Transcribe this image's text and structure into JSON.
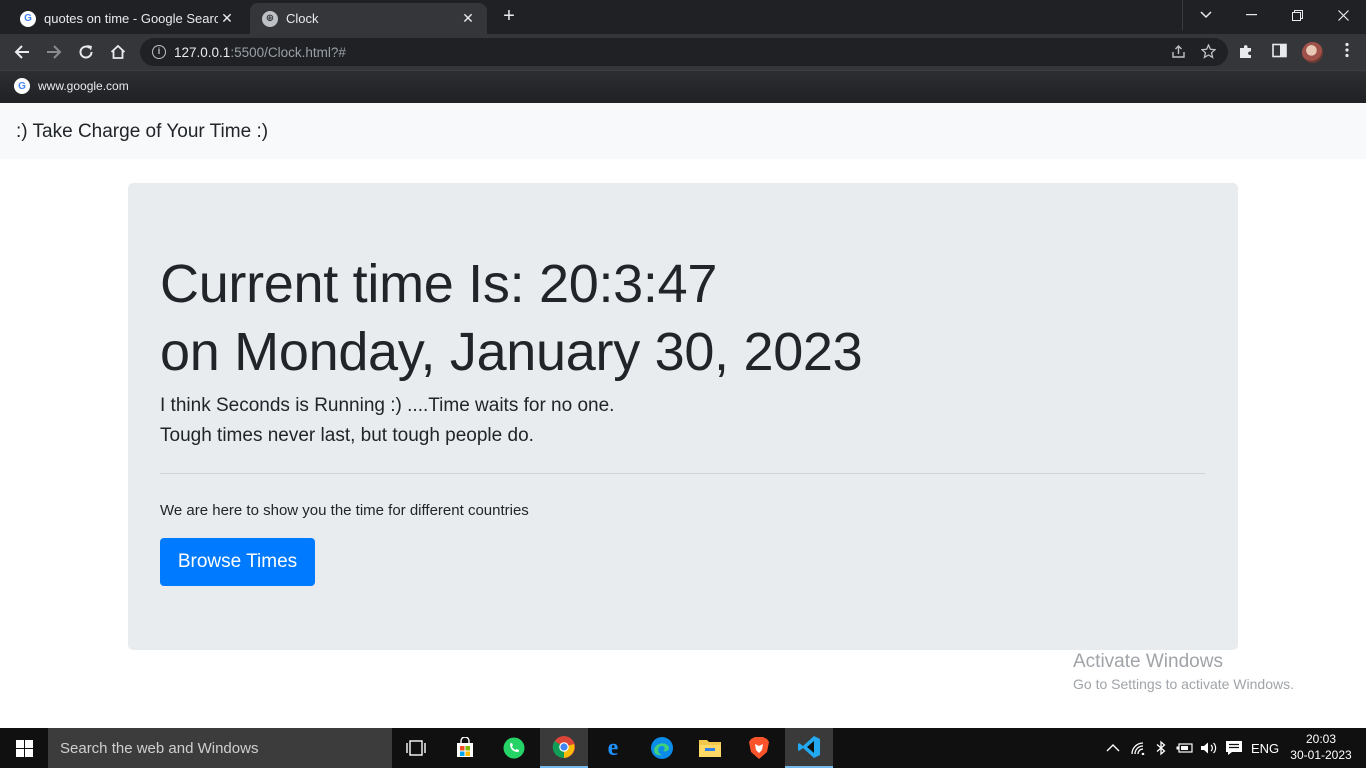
{
  "browser": {
    "tabs": [
      {
        "title": "quotes on time - Google Search",
        "favicon": "google-favicon",
        "active": false
      },
      {
        "title": "Clock",
        "favicon": "globe-favicon",
        "active": true
      }
    ],
    "url": {
      "host": "127.0.0.1",
      "rest": ":5500/Clock.html?#"
    },
    "bookmark": "www.google.com",
    "new_tab_symbol": "+",
    "tab_close_symbol": "✕"
  },
  "page": {
    "brand": ":) Take Charge of Your Time :)",
    "jumbotron": {
      "time_line": "Current time Is: 20:3:47",
      "date_line": "on Monday, January 30, 2023",
      "lead_1": "I think Seconds is Running :) ....Time waits for no one.",
      "lead_2": "Tough times never last, but tough people do.",
      "paragraph": "We are here to show you the time for different countries",
      "button": "Browse Times"
    },
    "colors": {
      "primary": "#007bff",
      "jumbotron_bg": "#e9ecef",
      "navbar_bg": "#f8f9fa"
    }
  },
  "watermark": {
    "title": "Activate Windows",
    "subtitle": "Go to Settings to activate Windows."
  },
  "taskbar": {
    "search_placeholder": "Search the web and Windows",
    "language": "ENG",
    "time": "20:03",
    "date": "30-01-2023"
  }
}
